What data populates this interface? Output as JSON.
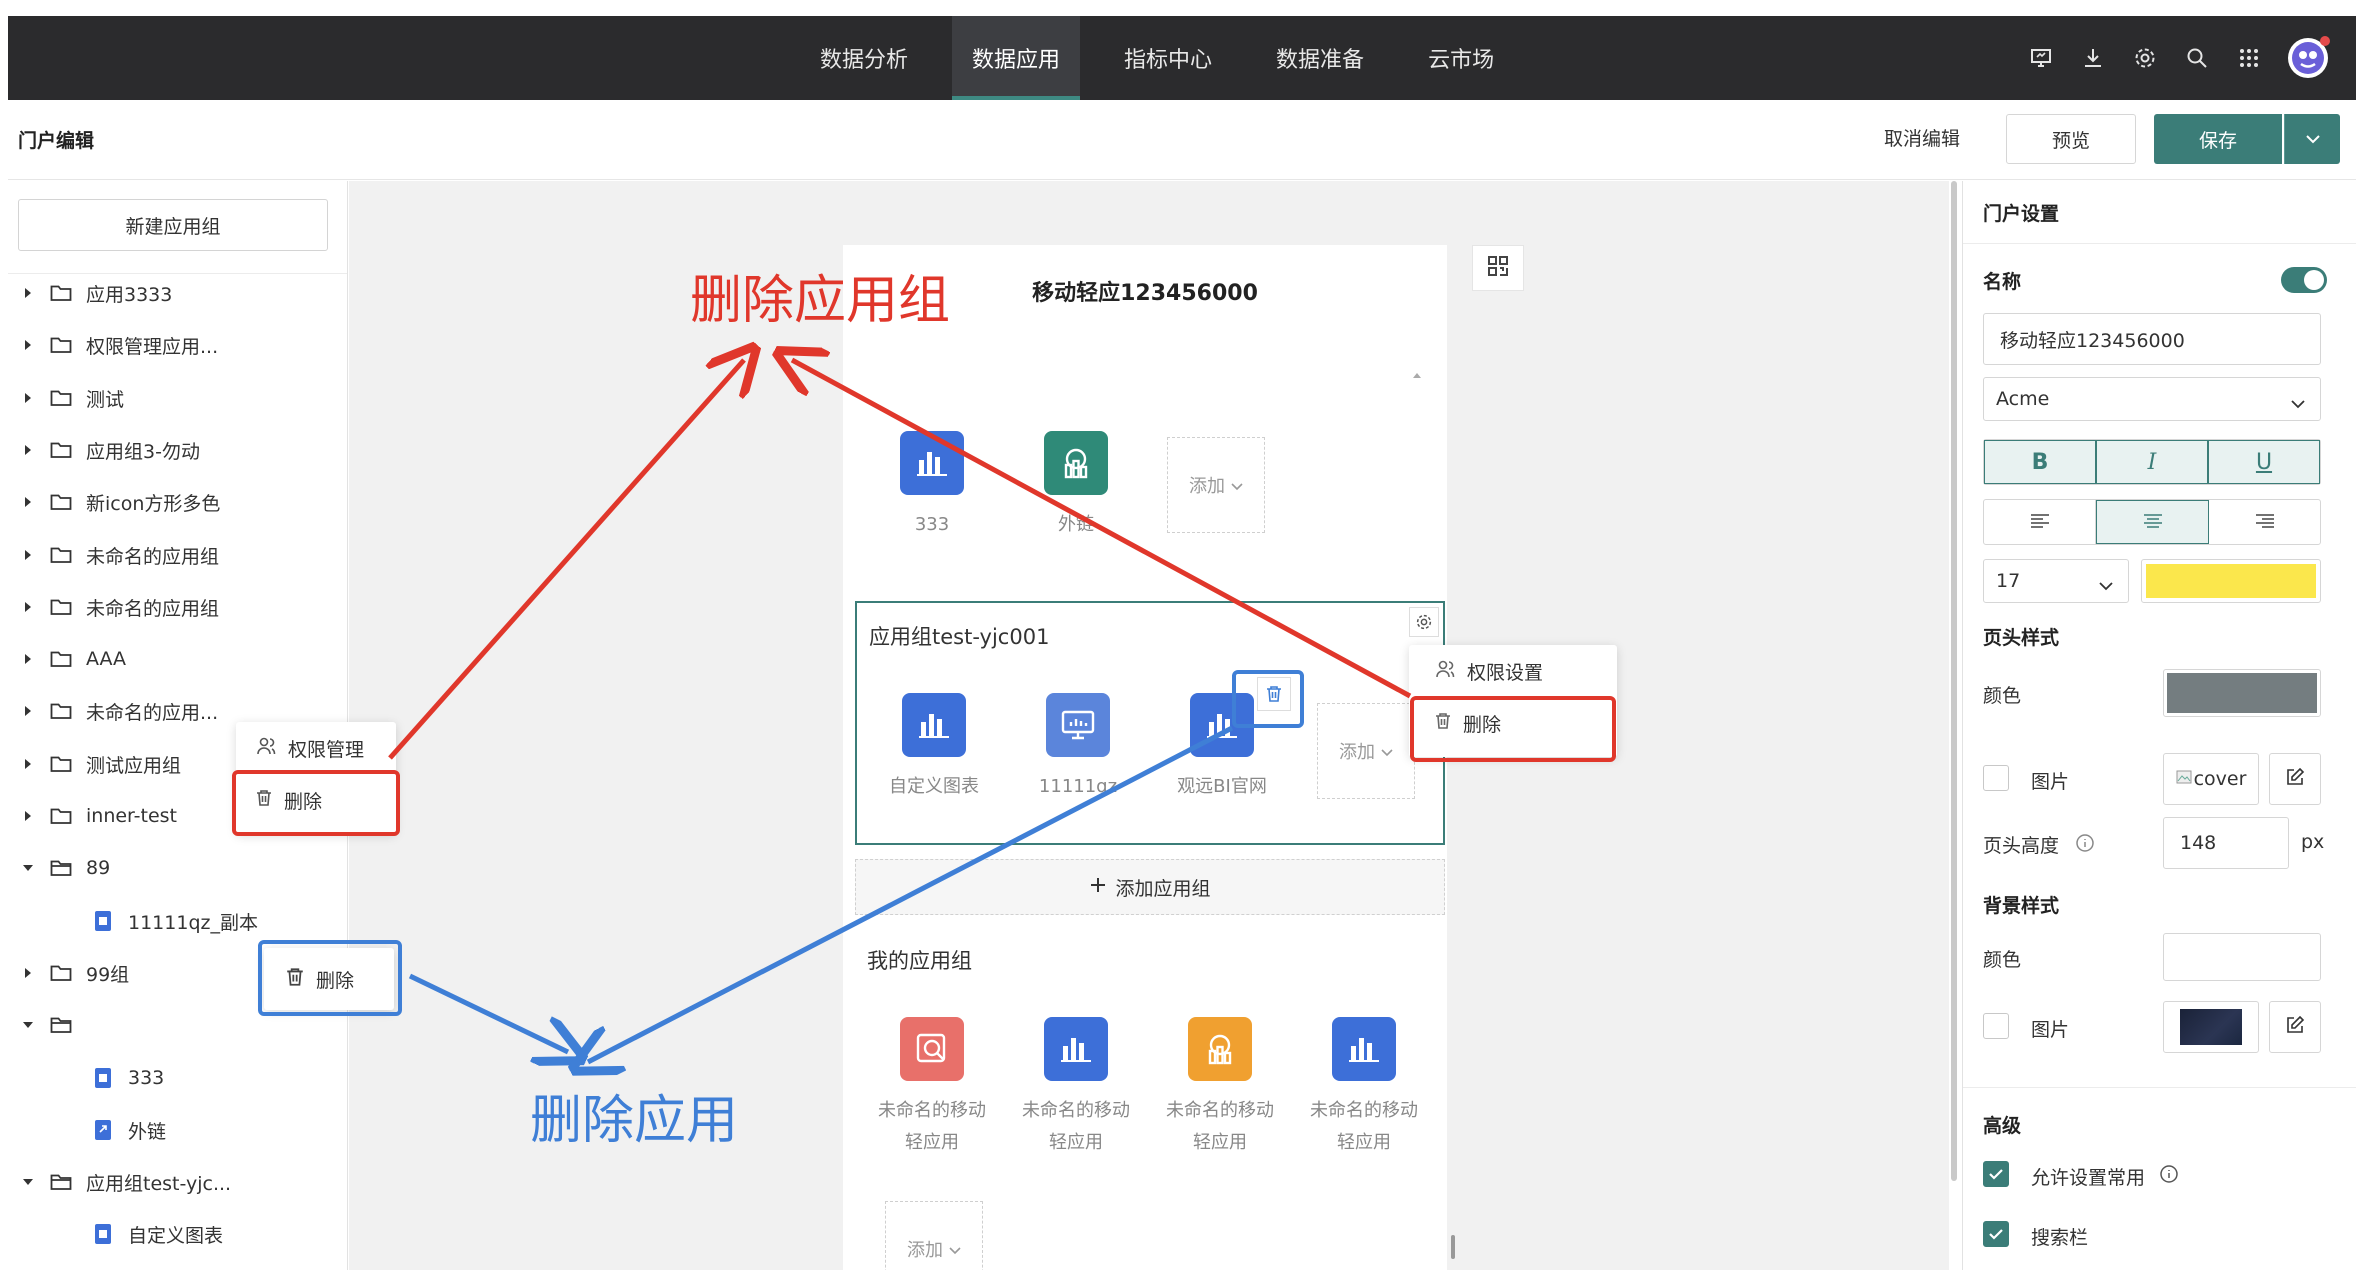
{
  "topnav": {
    "menu": [
      "数据分析",
      "数据应用",
      "指标中心",
      "数据准备",
      "云市场"
    ],
    "active_index": 1,
    "tools": [
      "screen-icon",
      "download-icon",
      "gear-icon",
      "search-icon",
      "grid-icon",
      "avatar"
    ]
  },
  "header": {
    "title": "门户编辑",
    "cancel": "取消编辑",
    "preview": "预览",
    "save": "保存"
  },
  "sidebar": {
    "new_group": "新建应用组",
    "tree": [
      {
        "label": "应用3333",
        "type": "folder",
        "expanded": false
      },
      {
        "label": "权限管理应用...",
        "type": "folder",
        "expanded": false
      },
      {
        "label": "测试",
        "type": "folder",
        "expanded": false
      },
      {
        "label": "应用组3-勿动",
        "type": "folder",
        "expanded": false
      },
      {
        "label": "新icon方形多色",
        "type": "folder",
        "expanded": false
      },
      {
        "label": "未命名的应用组",
        "type": "folder",
        "expanded": false
      },
      {
        "label": "未命名的应用组",
        "type": "folder",
        "expanded": false
      },
      {
        "label": "AAA",
        "type": "folder",
        "expanded": false
      },
      {
        "label": "未命名的应用...",
        "type": "folder",
        "expanded": false
      },
      {
        "label": "测试应用组",
        "type": "folder",
        "expanded": false
      },
      {
        "label": "inner-test",
        "type": "folder",
        "expanded": false
      },
      {
        "label": "89",
        "type": "folder",
        "expanded": true
      },
      {
        "label": "11111qz_副本",
        "type": "file",
        "expanded": false
      },
      {
        "label": "99组",
        "type": "folder",
        "expanded": false
      },
      {
        "label": "",
        "type": "folder",
        "expanded": true
      },
      {
        "label": "333",
        "type": "file",
        "expanded": false
      },
      {
        "label": "外链",
        "type": "link",
        "expanded": false
      },
      {
        "label": "应用组test-yjc...",
        "type": "folder",
        "expanded": true
      },
      {
        "label": "自定义图表",
        "type": "file",
        "expanded": false
      }
    ],
    "context_menu": {
      "items": [
        "权限管理",
        "删除"
      ]
    },
    "app_delete_popup": "删除"
  },
  "canvas": {
    "phone_title": "移动轻应123456000",
    "section1": {
      "apps": [
        {
          "label": "333",
          "color": "#3d6fd8"
        },
        {
          "label": "外链",
          "color": "#2f8a78"
        }
      ],
      "add": "添加"
    },
    "section2": {
      "title": "应用组test-yjc001",
      "apps": [
        {
          "label": "自定义图表",
          "color": "#3d6fd8"
        },
        {
          "label": "11111qz",
          "color": "#5b85db"
        },
        {
          "label": "观远BI官网",
          "color": "#3d6fd8"
        }
      ],
      "add": "添加",
      "menu": [
        "权限设置",
        "删除"
      ]
    },
    "add_group": "添加应用组",
    "section3": {
      "title": "我的应用组",
      "apps": [
        {
          "label": "未命名的移动轻应用",
          "color": "#e8706a"
        },
        {
          "label": "未命名的移动轻应用",
          "color": "#3d6fd8"
        },
        {
          "label": "未命名的移动轻应用",
          "color": "#f0a030"
        },
        {
          "label": "未命名的移动轻应用",
          "color": "#3d6fd8"
        }
      ],
      "add": "添加"
    }
  },
  "annotations": {
    "delete_group": "删除应用组",
    "delete_app": "删除应用",
    "red": "#e0372b",
    "blue": "#3f7fd6"
  },
  "panel": {
    "title": "门户设置",
    "name_label": "名称",
    "name_value": "移动轻应123456000",
    "font": "Acme",
    "font_size": "17",
    "font_color": "#fbe74c",
    "header_style": "页头样式",
    "color_label": "颜色",
    "header_color": "#747d80",
    "image_label": "图片",
    "cover_alt": "cover",
    "height_label": "页头高度",
    "height_value": "148",
    "height_unit": "px",
    "bg_style": "背景样式",
    "bg_color_label": "颜色",
    "bg_image_label": "图片",
    "advanced": "高级",
    "allow_common": "允许设置常用",
    "search_bar": "搜索栏",
    "accent": "#3b7d78"
  }
}
